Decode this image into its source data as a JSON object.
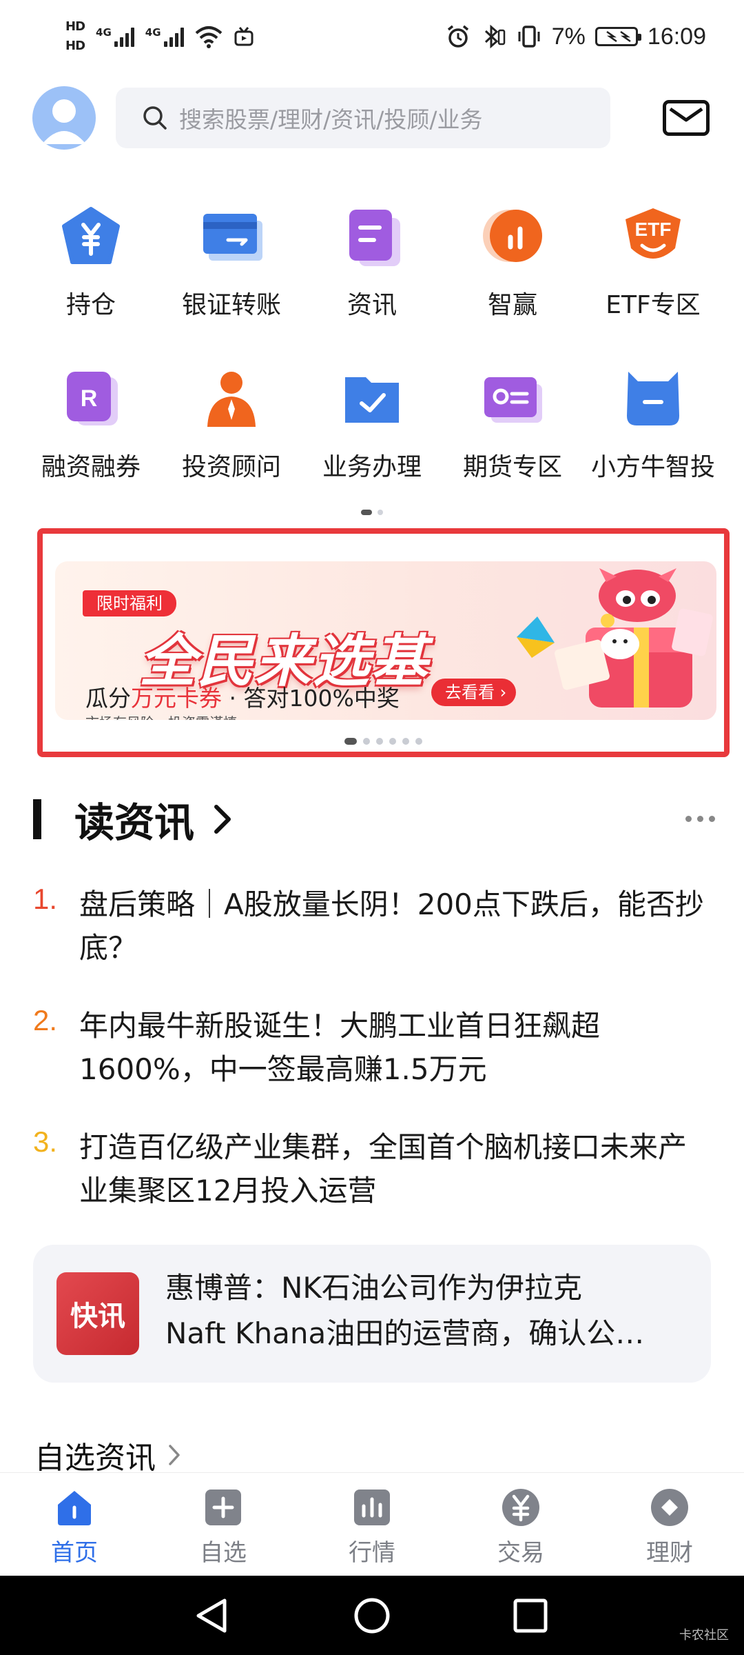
{
  "status_bar": {
    "hd1": "HD",
    "hd2": "HD",
    "net1": "4G",
    "net2": "4G",
    "battery": "7%",
    "time": "16:09"
  },
  "header": {
    "search_placeholder": "搜索股票/理财/资讯/投顾/业务"
  },
  "shortcuts": [
    {
      "label": "持仓",
      "icon": "yuan-shield-icon"
    },
    {
      "label": "银证转账",
      "icon": "card-transfer-icon"
    },
    {
      "label": "资讯",
      "icon": "document-icon"
    },
    {
      "label": "智赢",
      "icon": "bar-chart-circle-icon"
    },
    {
      "label": "ETF专区",
      "icon": "etf-badge-icon"
    },
    {
      "label": "融资融券",
      "icon": "r-badge-icon"
    },
    {
      "label": "投资顾问",
      "icon": "advisor-icon"
    },
    {
      "label": "业务办理",
      "icon": "folder-check-icon"
    },
    {
      "label": "期货专区",
      "icon": "futures-card-icon"
    },
    {
      "label": "小方牛智投",
      "icon": "bull-icon"
    }
  ],
  "banner": {
    "tag": "限时福利",
    "title": "全民来选基",
    "sub_prefix": "瓜分",
    "sub_highlight": "万元卡券",
    "sub_suffix": " · 答对100%中奖",
    "button": "去看看",
    "risk": "市场有风险，投资需谨慎"
  },
  "news_section": {
    "title": "读资讯",
    "items": [
      {
        "num": "1.",
        "text": "盘后策略｜A股放量长阴！200点下跌后，能否抄底？",
        "color": "#e8482f"
      },
      {
        "num": "2.",
        "text": "年内最牛新股诞生！大鹏工业首日狂飙超1600%，中一签最高赚1.5万元",
        "color": "#f07a1c"
      },
      {
        "num": "3.",
        "text": "打造百亿级产业集群，全国首个脑机接口未来产业集聚区12月投入运营",
        "color": "#f2b21e"
      }
    ]
  },
  "flash": {
    "logo": "快讯",
    "line1": "惠博普：NK石油公司作为伊拉克",
    "line2": "Naft Khana油田的运营商，确认公…"
  },
  "watchlist_news": {
    "title": "自选资讯"
  },
  "tabs": [
    {
      "label": "首页",
      "icon": "home-icon"
    },
    {
      "label": "自选",
      "icon": "plus-square-icon"
    },
    {
      "label": "行情",
      "icon": "market-chart-icon"
    },
    {
      "label": "交易",
      "icon": "yuan-circle-icon"
    },
    {
      "label": "理财",
      "icon": "diamond-circle-icon"
    }
  ],
  "watermark": "卡农社区",
  "colors": {
    "accent": "#2f6fe8",
    "banner_red": "#e8393c"
  }
}
